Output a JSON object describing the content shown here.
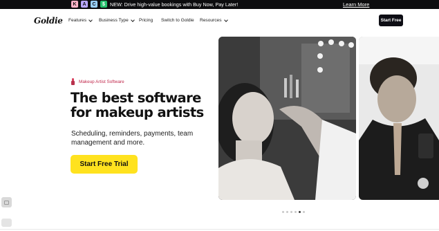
{
  "announcement": {
    "payment_icons": [
      {
        "name": "klarna-icon",
        "glyph": "K"
      },
      {
        "name": "affirm-icon",
        "glyph": "A"
      },
      {
        "name": "cherry-icon",
        "glyph": "C"
      },
      {
        "name": "dollar-icon",
        "glyph": "$"
      }
    ],
    "message": "NEW: Drive high-value bookings with Buy Now, Pay Later!",
    "link": "Learn More"
  },
  "nav": {
    "logo": "Goldie",
    "items": [
      {
        "label": "Features",
        "has_dropdown": true
      },
      {
        "label": "Business Type",
        "has_dropdown": true
      },
      {
        "label": "Pricing",
        "has_dropdown": false
      },
      {
        "label": "Switch to Goldie",
        "has_dropdown": false
      },
      {
        "label": "Resources",
        "has_dropdown": true
      }
    ],
    "cta": "Start Free"
  },
  "hero": {
    "eyebrow_icon": "lipstick-icon",
    "eyebrow": "Makeup Artist Software",
    "headline_line1": "The best software",
    "headline_line2": "for makeup artists",
    "subcopy": "Scheduling, reminders, payments, team management and more.",
    "cta": "Start Free Trial"
  },
  "carousel": {
    "slide_count": 6,
    "active_index": 4
  },
  "colors": {
    "announcement_bg": "#0d0d0f",
    "cta_yellow": "#ffe21f",
    "eyebrow_accent": "#c0274b",
    "nav_button_bg": "#0d0d14"
  }
}
